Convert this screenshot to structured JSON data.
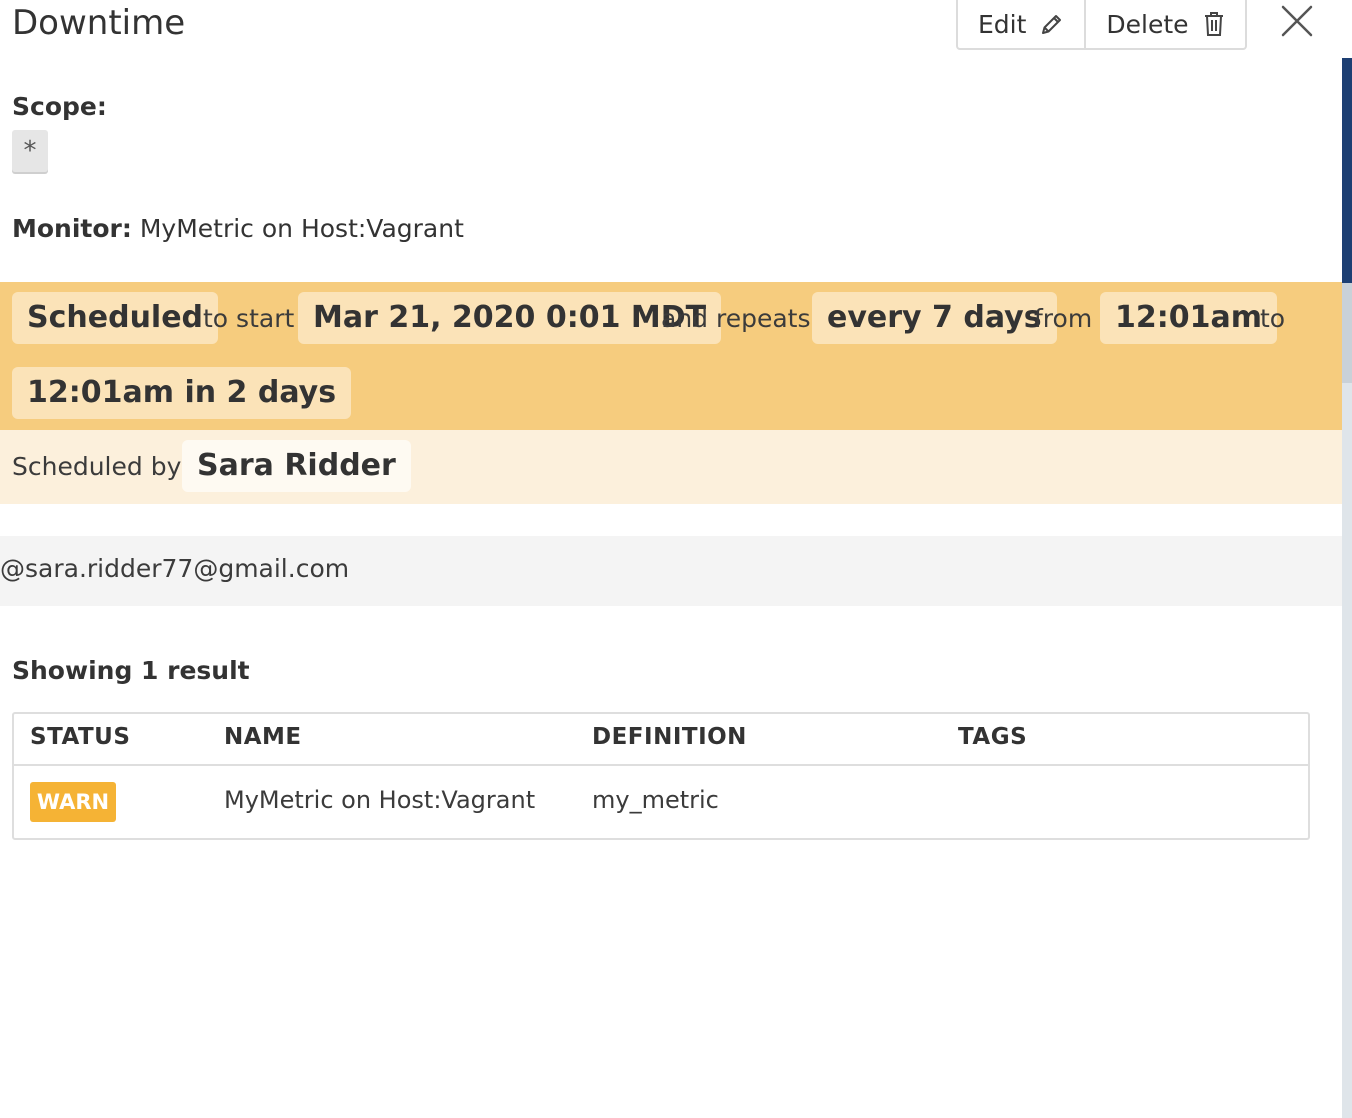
{
  "header": {
    "title": "Downtime",
    "edit_label": "Edit",
    "delete_label": "Delete"
  },
  "scope": {
    "label": "Scope:",
    "value": "*"
  },
  "monitor": {
    "label": "Monitor:",
    "value": "MyMetric on Host:Vagrant"
  },
  "schedule": {
    "status": "Scheduled",
    "to_start_text": "to start",
    "start": "Mar 21, 2020 0:01 MDT",
    "repeats_text": "and repeats",
    "repeat_interval": "every 7 days",
    "from_text": "from",
    "from_time": "12:01am",
    "to_text": "to",
    "to_time": "12:01am in 2 days"
  },
  "scheduled_by": {
    "label": "Scheduled by",
    "user": "Sara Ridder"
  },
  "message": {
    "text": "@sara.ridder77@gmail.com"
  },
  "results": {
    "summary": "Showing 1 result",
    "columns": [
      "STATUS",
      "NAME",
      "DEFINITION",
      "TAGS"
    ],
    "rows": [
      {
        "status": "WARN",
        "name": "MyMetric on Host:Vagrant",
        "definition": "my_metric",
        "tags": ""
      }
    ]
  },
  "colors": {
    "schedule_band": "#f6cc7e",
    "scheduled_by_band": "#fcf0dc",
    "warn": "#f5b335"
  }
}
